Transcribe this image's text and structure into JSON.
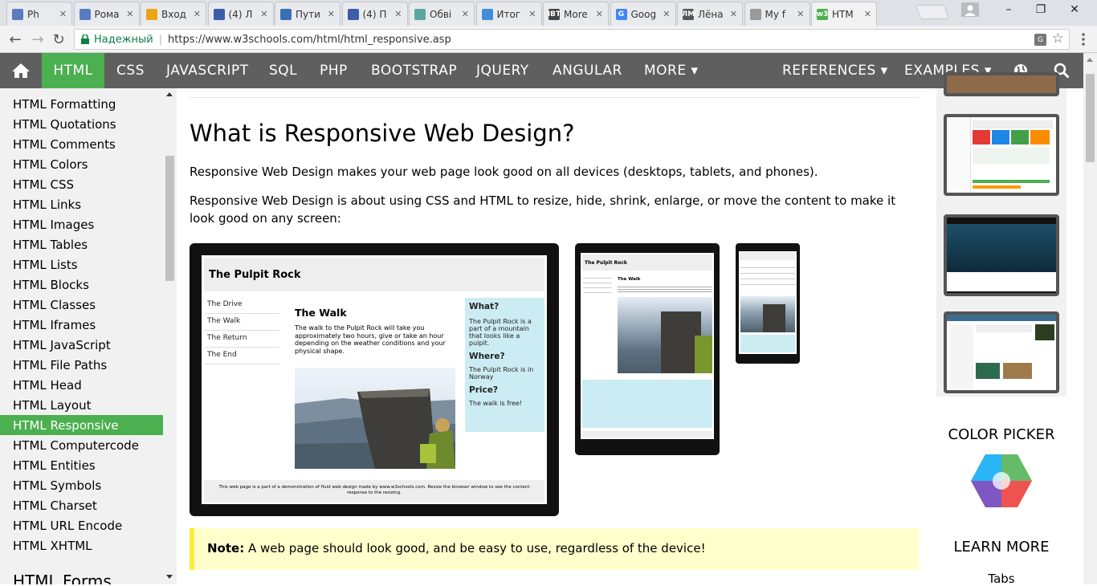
{
  "browser": {
    "tabs": [
      {
        "title": "Ph",
        "favicon": "play-icon",
        "color": "#5b7bc0"
      },
      {
        "title": "Рома",
        "favicon": "pause-icon",
        "color": "#5b7bc0"
      },
      {
        "title": "Вход",
        "favicon": "mail-at-icon",
        "color": "#e8a317"
      },
      {
        "title": "(4) Л",
        "favicon": "window-icon",
        "color": "#3b5ea8"
      },
      {
        "title": "Пути",
        "favicon": "swirl-icon",
        "color": "#3a6fb5"
      },
      {
        "title": "(4) П",
        "favicon": "window-icon",
        "color": "#3b5ea8"
      },
      {
        "title": "Обві",
        "favicon": "triangle-icon",
        "color": "#5aa7a0"
      },
      {
        "title": "Итог",
        "favicon": "edit-icon",
        "color": "#3f8fd8"
      },
      {
        "title": "More",
        "favicon": "ibt-icon",
        "label": "IBT",
        "color": "#444"
      },
      {
        "title": "Goog",
        "favicon": "google-g-icon",
        "label": "G",
        "color": "#4285f4"
      },
      {
        "title": "Лёна",
        "favicon": "lm-icon",
        "label": "ЛМ",
        "color": "#555"
      },
      {
        "title": "My f",
        "favicon": "file-icon",
        "color": "#999"
      },
      {
        "title": "HTM",
        "favicon": "w3-icon",
        "label": "w3",
        "color": "#4caf50"
      }
    ],
    "close_glyph": "✕",
    "window_controls": {
      "minimize": "–",
      "maximize": "❐",
      "close": "✕"
    },
    "back_glyph": "←",
    "forward_glyph": "→",
    "reload_glyph": "↻",
    "security_label": "Надежный",
    "url": "https://www.w3schools.com/html/html_responsive.asp"
  },
  "nav": {
    "items": [
      "HTML",
      "CSS",
      "JAVASCRIPT",
      "SQL",
      "PHP",
      "BOOTSTRAP",
      "JQUERY",
      "ANGULAR",
      "MORE ▾"
    ],
    "right_items": [
      "REFERENCES ▾",
      "EXAMPLES ▾"
    ],
    "accent": "#4caf50"
  },
  "sidebar": {
    "items": [
      "HTML Formatting",
      "HTML Quotations",
      "HTML Comments",
      "HTML Colors",
      "HTML CSS",
      "HTML Links",
      "HTML Images",
      "HTML Tables",
      "HTML Lists",
      "HTML Blocks",
      "HTML Classes",
      "HTML Iframes",
      "HTML JavaScript",
      "HTML File Paths",
      "HTML Head",
      "HTML Layout",
      "HTML Responsive",
      "HTML Computercode",
      "HTML Entities",
      "HTML Symbols",
      "HTML Charset",
      "HTML URL Encode",
      "HTML XHTML"
    ],
    "active": "HTML Responsive",
    "section_heading": "HTML Forms"
  },
  "main": {
    "heading": "What is Responsive Web Design?",
    "para1": "Responsive Web Design makes your web page look good on all devices (desktops, tablets, and phones).",
    "para2": "Responsive Web Design is about using CSS and HTML to resize, hide, shrink, enlarge, or move the content to make it look good on any screen:",
    "demo": {
      "title": "The Pulpit Rock",
      "menu": [
        "The Drive",
        "The Walk",
        "The Return",
        "The End"
      ],
      "walk_heading": "The Walk",
      "walk_text": "The walk to the Pulpit Rock will take you approximately two hours, give or take an hour depending on the weather conditions and your physical shape.",
      "what_heading": "What?",
      "what_text": "The Pulpit Rock is a part of a mountain that looks like a pulpit.",
      "where_heading": "Where?",
      "where_text": "The Pulpit Rock is in Norway",
      "price_heading": "Price?",
      "price_text": "The walk is free!",
      "footer": "This web page is a part of a demonstration of fluid web design made by www.w3schools.com. Resize the browser window to see the content response to the resizing."
    },
    "note_label": "Note:",
    "note_text": " A web page should look good, and be easy to use, regardless of the device!"
  },
  "right": {
    "color_picker": "COLOR PICKER",
    "learn_more": "LEARN MORE",
    "tabs": "Tabs"
  }
}
